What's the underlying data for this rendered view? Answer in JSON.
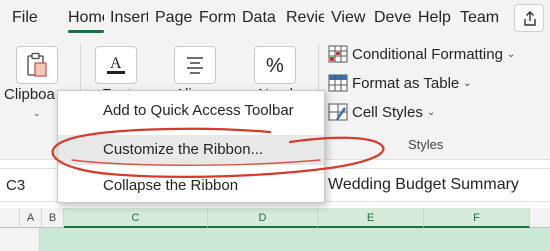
{
  "tabs": [
    {
      "label": "File",
      "active": false
    },
    {
      "label": "Home",
      "active": true
    },
    {
      "label": "Insert",
      "active": false
    },
    {
      "label": "Page Layout",
      "active": false
    },
    {
      "label": "Formulas",
      "active": false
    },
    {
      "label": "Data",
      "active": false
    },
    {
      "label": "Review",
      "active": false
    },
    {
      "label": "View",
      "active": false
    },
    {
      "label": "Developer",
      "active": false
    },
    {
      "label": "Help",
      "active": false
    },
    {
      "label": "Team",
      "active": false
    }
  ],
  "ribbon": {
    "clipboard_label": "Clipboard",
    "font_label": "Font",
    "alignment_label": "Alignment",
    "number_label": "Number",
    "styles": {
      "conditional_formatting": "Conditional Formatting",
      "format_as_table": "Format as Table",
      "cell_styles": "Cell Styles",
      "group_label": "Styles"
    }
  },
  "formula_bar": {
    "name_box": "C3",
    "content": "Wedding Budget Summary"
  },
  "columns": [
    "A",
    "B",
    "C",
    "D",
    "E",
    "F"
  ],
  "context_menu": {
    "items": [
      {
        "label": "Add to Quick Access Toolbar",
        "hovered": false
      },
      {
        "label": "Customize the Ribbon...",
        "hovered": true
      },
      {
        "label": "Collapse the Ribbon",
        "hovered": false
      }
    ]
  },
  "colors": {
    "accent": "#1f6e43",
    "annotation": "#d63a2b",
    "selection": "#c9e8d6"
  }
}
